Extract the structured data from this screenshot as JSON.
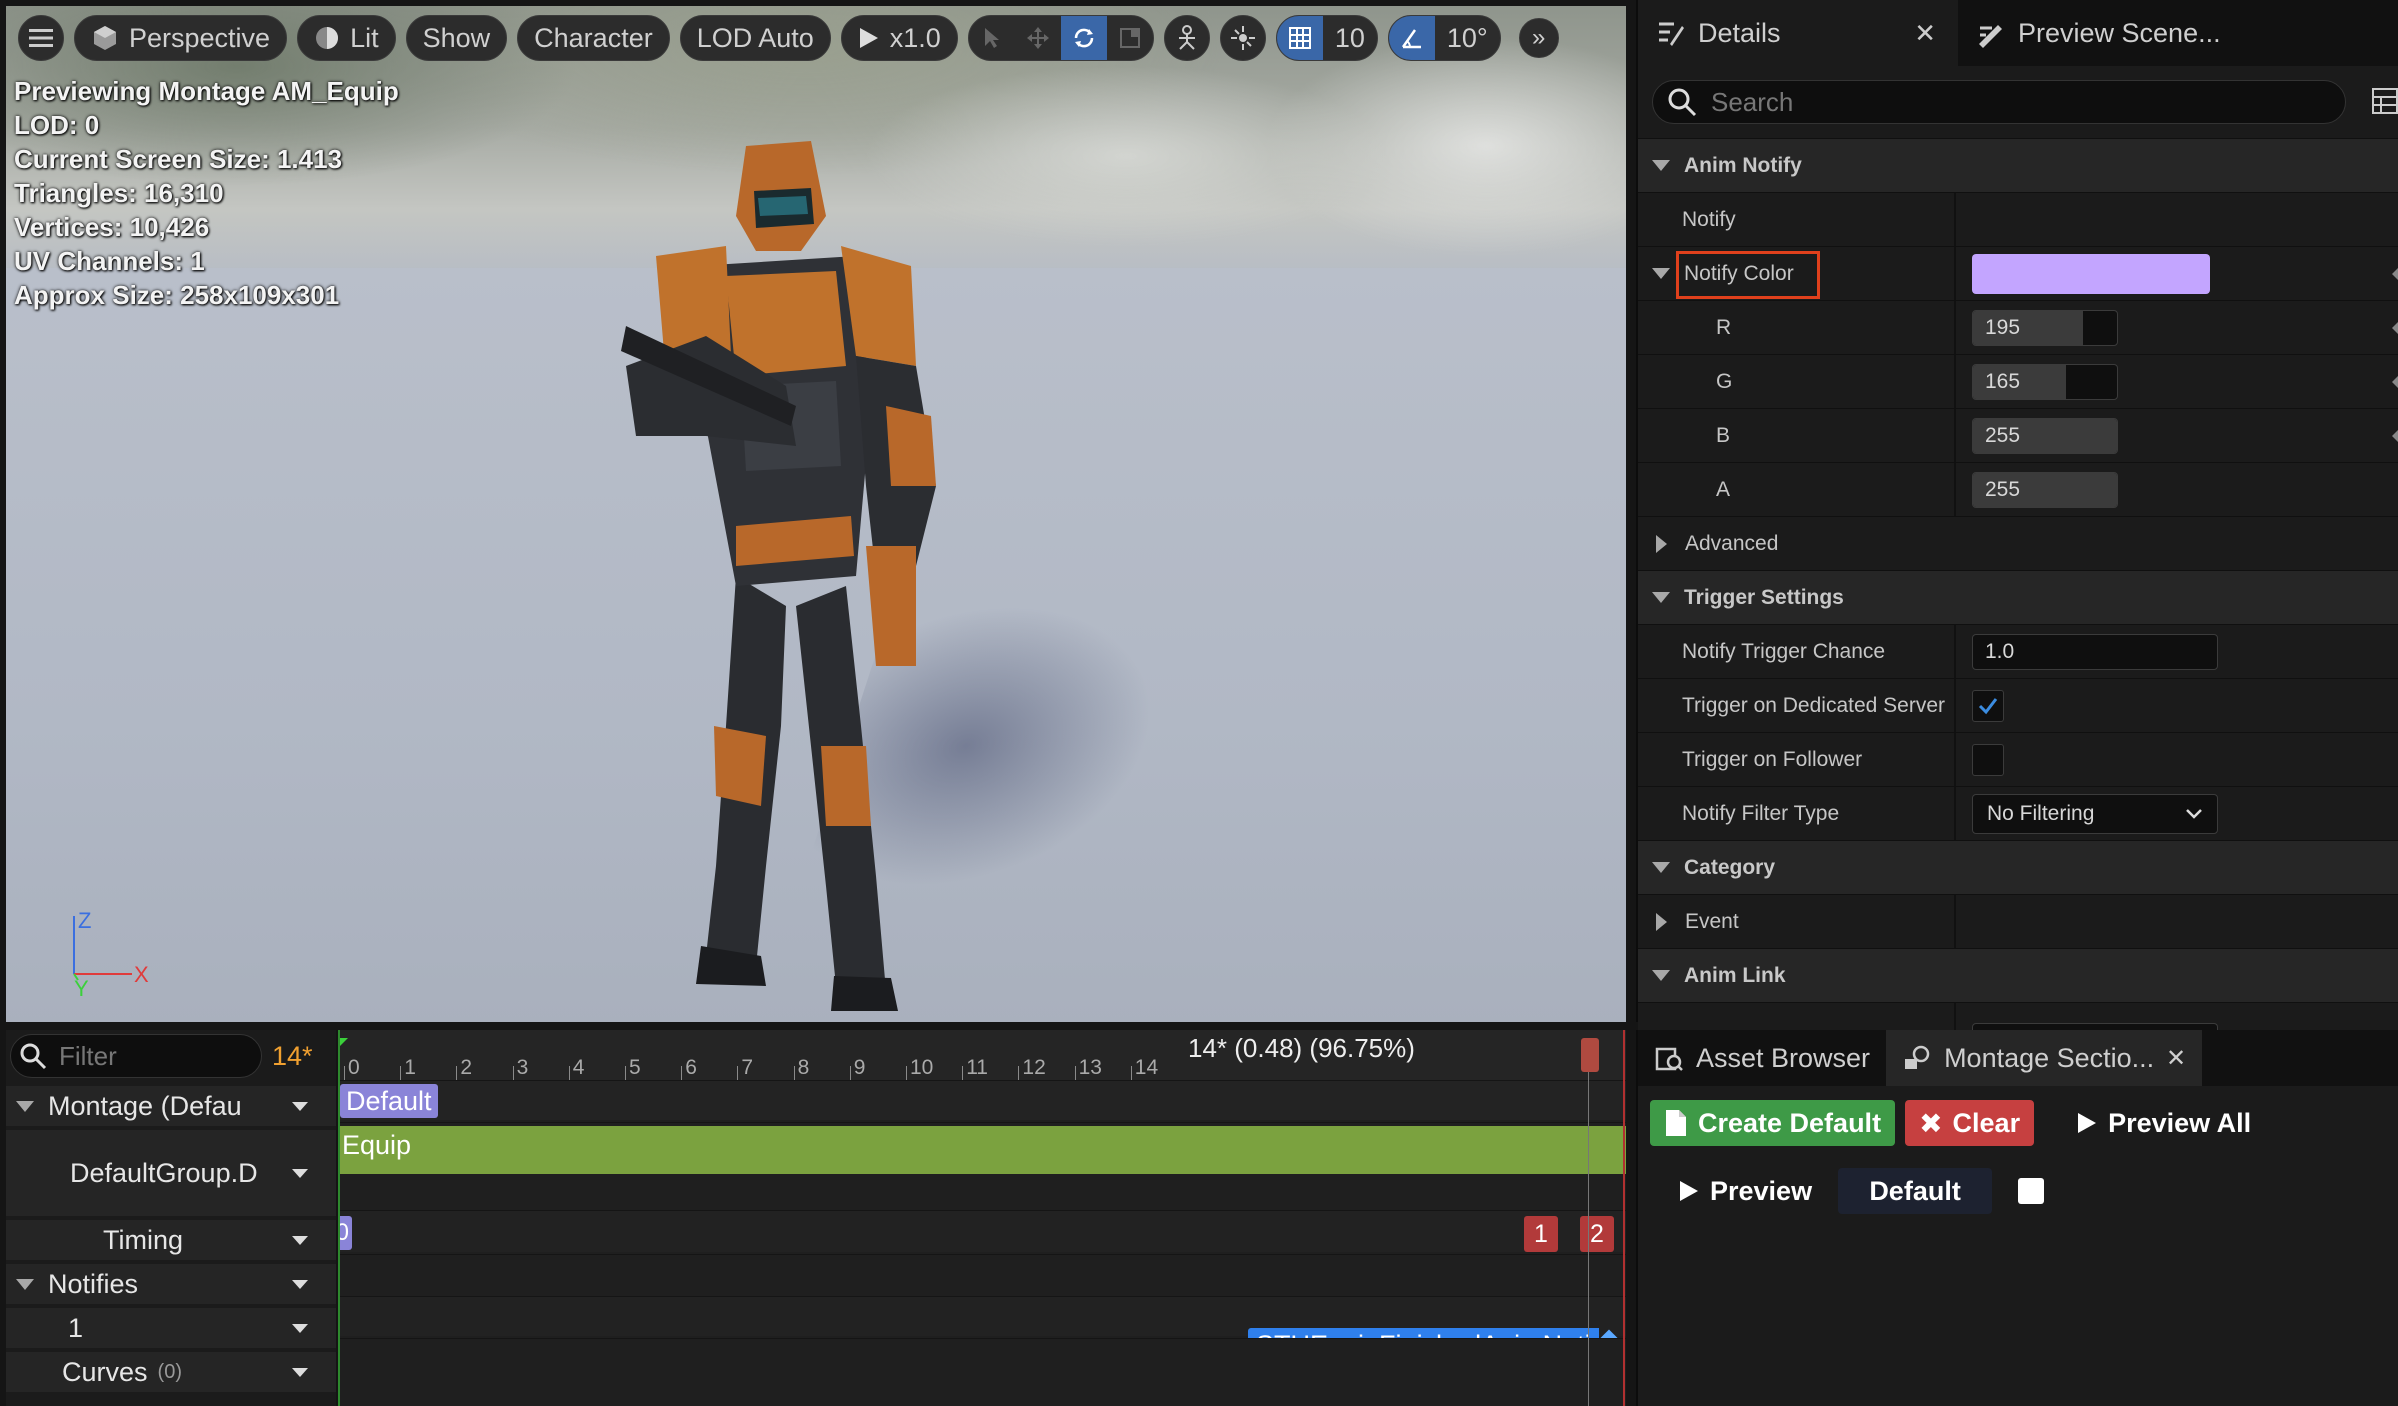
{
  "viewport": {
    "toolbar": {
      "perspective": "Perspective",
      "lit": "Lit",
      "show": "Show",
      "character": "Character",
      "lod": "LOD Auto",
      "play_speed": "x1.0",
      "grid_size": "10",
      "angle_snap": "10°"
    },
    "stats": [
      "Previewing Montage AM_Equip",
      "LOD: 0",
      "Current Screen Size: 1.413",
      "Triangles: 16,310",
      "Vertices: 10,426",
      "UV Channels: 1",
      "Approx Size: 258x109x301"
    ],
    "axis": {
      "z": "Z",
      "y": "Y",
      "x": "X"
    }
  },
  "details": {
    "tabs": [
      {
        "label": "Details",
        "icon": "details-icon"
      },
      {
        "label": "Preview Scene...",
        "icon": "preview-scene-icon"
      }
    ],
    "search_placeholder": "Search",
    "sections": {
      "anim_notify": "Anim Notify",
      "trigger_settings": "Trigger Settings",
      "category": "Category",
      "anim_link": "Anim Link"
    },
    "props": {
      "notify": "Notify",
      "notify_color": "Notify Color",
      "notify_color_hex": "#C3A5FF",
      "r_label": "R",
      "r_value": "195",
      "r_fraction": 0.765,
      "g_label": "G",
      "g_value": "165",
      "g_fraction": 0.647,
      "b_label": "B",
      "b_value": "255",
      "b_fraction": 1.0,
      "a_label": "A",
      "a_value": "255",
      "a_fraction": 1.0,
      "advanced": "Advanced",
      "trigger_chance": "Notify Trigger Chance",
      "trigger_chance_value": "1.0",
      "dedicated_server": "Trigger on Dedicated Server",
      "dedicated_server_checked": true,
      "follower": "Trigger on Follower",
      "follower_checked": false,
      "filter_type": "Notify Filter Type",
      "filter_type_value": "No Filtering",
      "event": "Event"
    }
  },
  "montage": {
    "filter_placeholder": "Filter",
    "current_frame": "14*",
    "tracks": {
      "montage": "Montage (Defau",
      "group": "DefaultGroup.D",
      "timing": "Timing",
      "notifies": "Notifies",
      "notify_track": "1",
      "curves": "Curves",
      "curves_count": "(0)"
    },
    "ruler_labels": [
      "0",
      "1",
      "2",
      "3",
      "4",
      "5",
      "6",
      "7",
      "8",
      "9",
      "10",
      "11",
      "12",
      "13",
      "14"
    ],
    "playhead_label": "14* (0.48) (96.75%)",
    "section_label": "Default",
    "slot_label": "Equip",
    "timing_start": "0",
    "timing_markers": [
      "1",
      "2"
    ],
    "notify_label": "STUEquipFinishedAnimNoti"
  },
  "bottom_right": {
    "tabs": [
      {
        "label": "Asset Browser",
        "icon": "asset-browser-icon"
      },
      {
        "label": "Montage Sectio...",
        "icon": "montage-sections-icon"
      }
    ],
    "create_default": "Create Default",
    "clear": "Clear",
    "preview_all": "Preview All",
    "preview": "Preview",
    "default_section": "Default"
  },
  "colors": {
    "accent_blue": "#3A67A8",
    "slot_green": "#7BA23F",
    "section_purple": "#8A84D8",
    "notify_blue": "#2F80ED",
    "marker_red": "#B23A3A",
    "create_green": "#3E9A47",
    "clear_red": "#C64040",
    "highlight_red": "#E0401C"
  }
}
